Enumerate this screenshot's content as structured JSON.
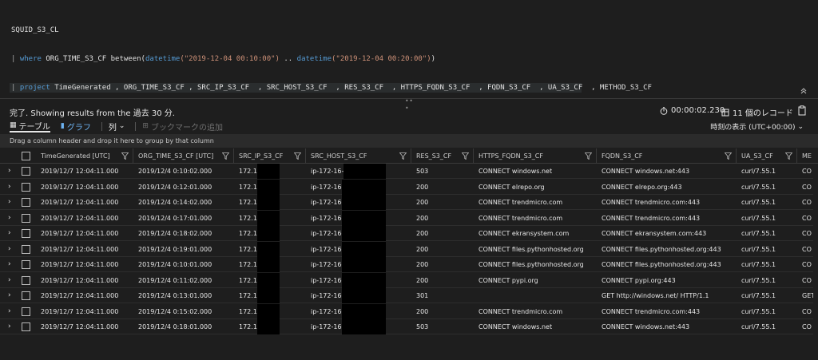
{
  "query": {
    "table_name": "SQUID_S3_CL",
    "line2": {
      "pipe": "| ",
      "kw": "where",
      "col": " ORG_TIME_S3_CF between(",
      "fn1": "datetime",
      "str1": "(\"2019-12-04 00:10:00\")",
      "mid": " .. ",
      "fn2": "datetime",
      "str2": "(\"2019-12-04 00:20:00\")",
      "end": ")"
    },
    "line3": {
      "pipe": "| ",
      "kw": "project",
      "cols": " TimeGenerated , ORG_TIME_S3_CF , SRC_IP_S3_CF  , SRC_HOST_S3_CF  , RES_S3_CF  , HTTPS_FQDN_S3_CF  , FQDN_S3_CF  , UA_S3_CF  , METHOD_S3_CF"
    },
    "collapse_icon": "double-chevron-up-icon"
  },
  "results": {
    "status_text": "完了. Showing results from the 過去 30 分.",
    "duration": "00:00:02.230",
    "records": "11 個のレコード",
    "tabs": {
      "table": "テーブル",
      "chart": "グラフ",
      "columns": "列",
      "bookmark": "ブックマークの追加"
    },
    "timezone_label": "時刻の表示 (UTC+00:00)",
    "group_hint": "Drag a column header and drop it here to group by that column"
  },
  "columns": [
    "TimeGenerated [UTC]",
    "ORG_TIME_S3_CF [UTC]",
    "SRC_IP_S3_CF",
    "SRC_HOST_S3_CF",
    "RES_S3_CF",
    "HTTPS_FQDN_S3_CF",
    "FQDN_S3_CF",
    "UA_S3_CF",
    "ME"
  ],
  "rows": [
    [
      "2019/12/7 12:04:11.000",
      "2019/12/4 0:10:02.000",
      "172.16.",
      "ip-172-16-",
      "503",
      "CONNECT windows.net",
      "CONNECT windows.net:443",
      "curl/7.55.1",
      "CO"
    ],
    [
      "2019/12/7 12:04:11.000",
      "2019/12/4 0:12:01.000",
      "172.16.",
      "ip-172-16-",
      "200",
      "CONNECT elrepo.org",
      "CONNECT elrepo.org:443",
      "curl/7.55.1",
      "CO"
    ],
    [
      "2019/12/7 12:04:11.000",
      "2019/12/4 0:14:02.000",
      "172.16.",
      "ip-172-16-",
      "200",
      "CONNECT trendmicro.com",
      "CONNECT trendmicro.com:443",
      "curl/7.55.1",
      "CO"
    ],
    [
      "2019/12/7 12:04:11.000",
      "2019/12/4 0:17:01.000",
      "172.16.",
      "ip-172-16-",
      "200",
      "CONNECT trendmicro.com",
      "CONNECT trendmicro.com:443",
      "curl/7.55.1",
      "CO"
    ],
    [
      "2019/12/7 12:04:11.000",
      "2019/12/4 0:18:02.000",
      "172.16.",
      "ip-172-16-",
      "200",
      "CONNECT ekransystem.com",
      "CONNECT ekransystem.com:443",
      "curl/7.55.1",
      "CO"
    ],
    [
      "2019/12/7 12:04:11.000",
      "2019/12/4 0:19:01.000",
      "172.16.",
      "ip-172-16-",
      "200",
      "CONNECT files.pythonhosted.org",
      "CONNECT files.pythonhosted.org:443",
      "curl/7.55.1",
      "CO"
    ],
    [
      "2019/12/7 12:04:11.000",
      "2019/12/4 0:10:01.000",
      "172.16.",
      "ip-172-16-",
      "200",
      "CONNECT files.pythonhosted.org",
      "CONNECT files.pythonhosted.org:443",
      "curl/7.55.1",
      "CO"
    ],
    [
      "2019/12/7 12:04:11.000",
      "2019/12/4 0:11:02.000",
      "172.16.",
      "ip-172-16-",
      "200",
      "CONNECT pypi.org",
      "CONNECT pypi.org:443",
      "curl/7.55.1",
      "CO"
    ],
    [
      "2019/12/7 12:04:11.000",
      "2019/12/4 0:13:01.000",
      "172.16.",
      "ip-172-16-",
      "301",
      "",
      "GET http://windows.net/ HTTP/1.1",
      "curl/7.55.1",
      "GET"
    ],
    [
      "2019/12/7 12:04:11.000",
      "2019/12/4 0:15:02.000",
      "172.16.",
      "ip-172-16-",
      "200",
      "CONNECT trendmicro.com",
      "CONNECT trendmicro.com:443",
      "curl/7.55.1",
      "CO"
    ],
    [
      "2019/12/7 12:04:11.000",
      "2019/12/4 0:18:01.000",
      "172.16.",
      "ip-172-16-",
      "503",
      "CONNECT windows.net",
      "CONNECT windows.net:443",
      "curl/7.55.1",
      "CO"
    ]
  ]
}
